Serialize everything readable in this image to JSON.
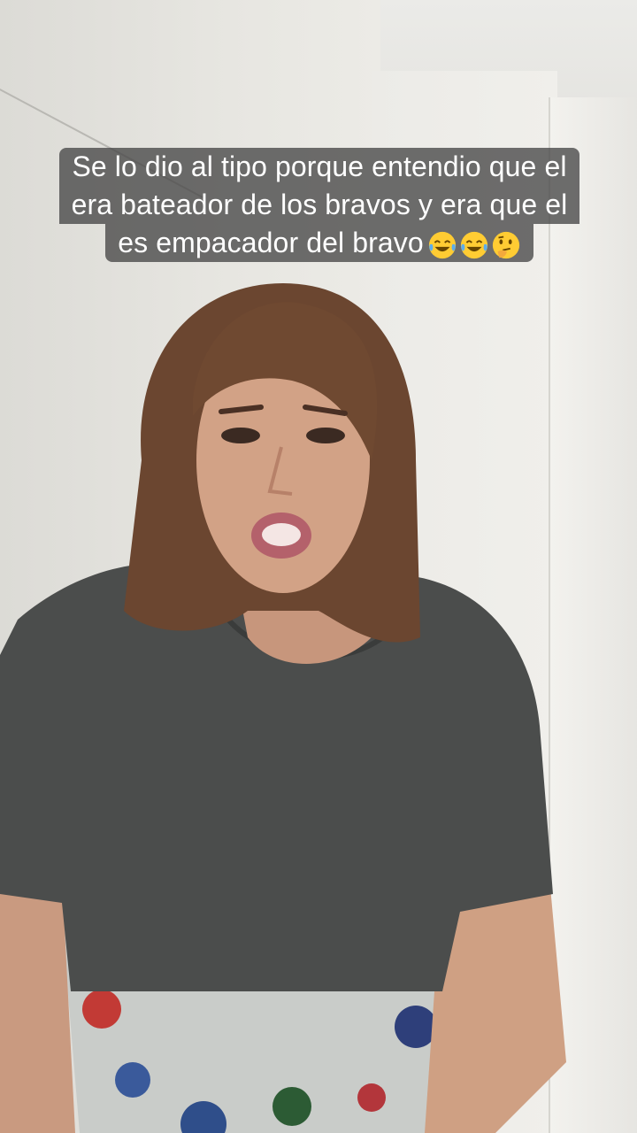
{
  "caption": {
    "line1": "Se lo dio al tipo porque entendio que el",
    "line2": "era bateador de los bravos y era que el",
    "line3": "es empacador del bravo",
    "emojis": [
      "tears-of-joy-emoji",
      "tears-of-joy-emoji",
      "thinking-face-emoji"
    ]
  },
  "colors": {
    "caption_background": "#464646",
    "caption_text": "#ffffff",
    "shirt": "#4a4c4b",
    "hair": "#6b4630",
    "wall": "#e9e8e3"
  }
}
